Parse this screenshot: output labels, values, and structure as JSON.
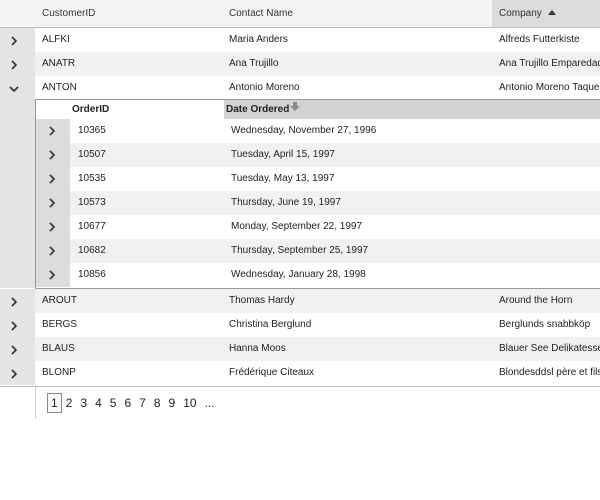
{
  "columns": {
    "customer_id": "CustomerID",
    "contact_name": "Contact Name",
    "company": "Company"
  },
  "customers_top": [
    {
      "id": "ALFKI",
      "contact": "Maria Anders",
      "company": "Alfreds Futterkiste"
    },
    {
      "id": "ANATR",
      "contact": "Ana Trujillo",
      "company": "Ana Trujillo Emparedados"
    },
    {
      "id": "ANTON",
      "contact": "Antonio Moreno",
      "company": "Antonio Moreno Taquería"
    }
  ],
  "detail": {
    "columns": {
      "order_id": "OrderID",
      "date_ordered": "Date Ordered"
    },
    "orders": [
      {
        "id": "10365",
        "date": "Wednesday, November 27, 1996"
      },
      {
        "id": "10507",
        "date": "Tuesday, April 15, 1997"
      },
      {
        "id": "10535",
        "date": "Tuesday, May 13, 1997"
      },
      {
        "id": "10573",
        "date": "Thursday, June 19, 1997"
      },
      {
        "id": "10677",
        "date": "Monday, September 22, 1997"
      },
      {
        "id": "10682",
        "date": "Thursday, September 25, 1997"
      },
      {
        "id": "10856",
        "date": "Wednesday, January 28, 1998"
      }
    ]
  },
  "customers_bottom": [
    {
      "id": "AROUT",
      "contact": "Thomas Hardy",
      "company": "Around the Horn"
    },
    {
      "id": "BERGS",
      "contact": "Christina Berglund",
      "company": "Berglunds snabbköp"
    },
    {
      "id": "BLAUS",
      "contact": "Hanna Moos",
      "company": "Blauer See Delikatessen"
    },
    {
      "id": "BLONP",
      "contact": "Frédérique Citeaux",
      "company": "Blondesddsl père et fils"
    }
  ],
  "pager": {
    "pages": [
      "1",
      "2",
      "3",
      "4",
      "5",
      "6",
      "7",
      "8",
      "9",
      "10",
      "..."
    ],
    "current": "1"
  },
  "icons": {
    "expand": "chevron-right-icon",
    "collapse": "chevron-down-icon",
    "sort_asc": "sort-ascending-icon",
    "sort_desc": "sort-descending-icon"
  }
}
